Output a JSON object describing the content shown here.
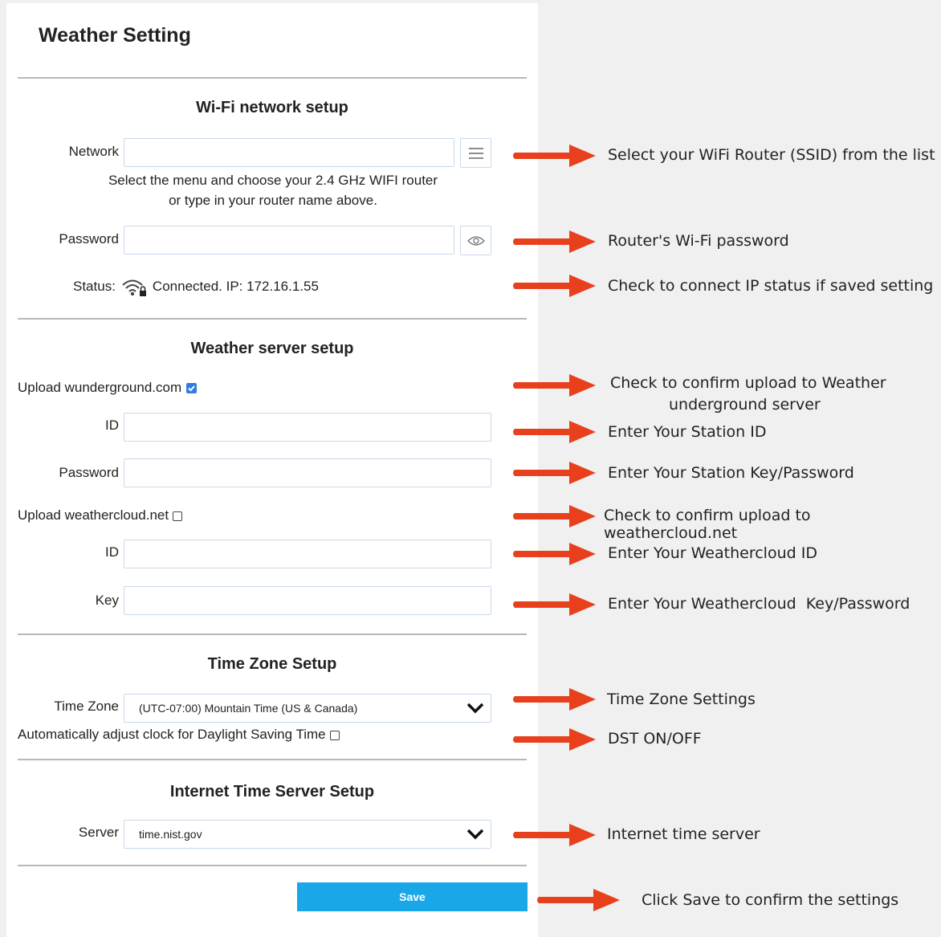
{
  "page": {
    "title": "Weather Setting"
  },
  "wifi": {
    "heading": "Wi-Fi network setup",
    "network_label": "Network",
    "network_value": "",
    "hint_line1": "Select the menu and choose your 2.4 GHz WIFI router",
    "hint_line2": "or type in your router name above.",
    "password_label": "Password",
    "password_value": "",
    "status_label": "Status:",
    "status_text": "Connected. IP: 172.16.1.55"
  },
  "weather_server": {
    "heading": "Weather server setup",
    "wunderground_label": "Upload wunderground.com",
    "wunderground_checked": true,
    "wu_id_label": "ID",
    "wu_password_label": "Password",
    "weathercloud_label": "Upload weathercloud.net",
    "weathercloud_checked": false,
    "wc_id_label": "ID",
    "wc_key_label": "Key"
  },
  "time_zone": {
    "heading": "Time Zone Setup",
    "label": "Time Zone",
    "selected": "(UTC-07:00) Mountain Time (US & Canada)",
    "dst_label": "Automatically adjust clock for Daylight Saving Time",
    "dst_checked": false
  },
  "time_server": {
    "heading": "Internet Time Server Setup",
    "label": "Server",
    "selected": "time.nist.gov"
  },
  "save_label": "Save",
  "annotations": [
    "Select your WiFi Router (SSID) from the list",
    "Router's Wi-Fi password",
    "Check to connect IP status if saved setting",
    "Check to confirm upload to Weather",
    "underground server",
    "Enter Your Station ID",
    "Enter Your Station Key/Password",
    "Check to confirm upload to weathercloud.net",
    "Enter Your Weathercloud ID",
    "Enter Your Weathercloud  Key/Password",
    "Time Zone Settings",
    "DST ON/OFF",
    "Internet time server",
    "Click Save to confirm the settings"
  ],
  "colors": {
    "arrow": "#e8401c",
    "save_button": "#1aa7e8",
    "checkbox_checked": "#2f7de1",
    "field_border": "#c9d8ea"
  }
}
